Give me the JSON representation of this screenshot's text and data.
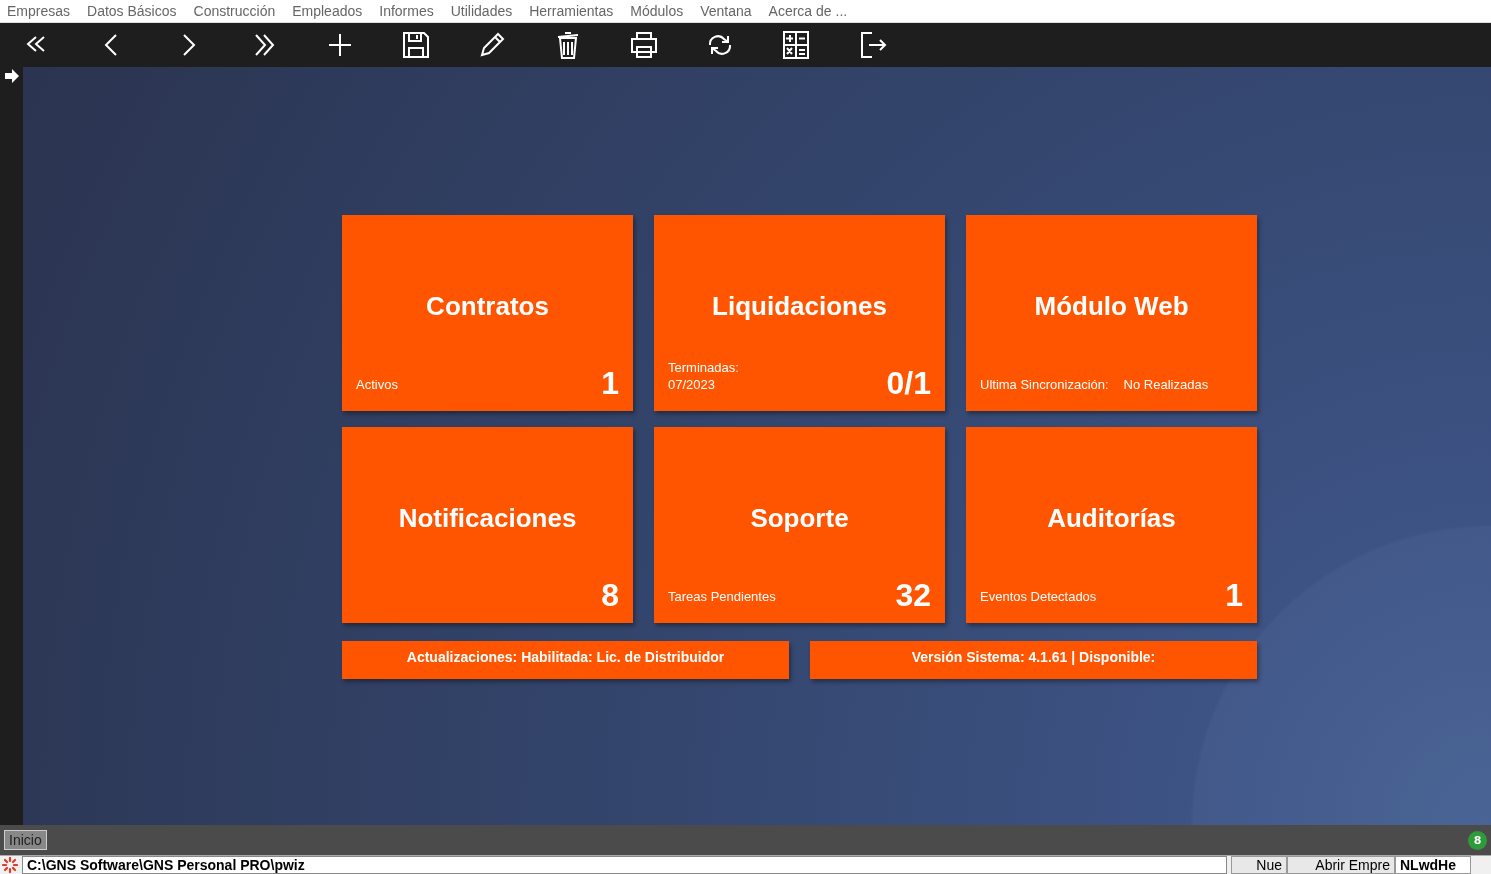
{
  "menu": [
    "Empresas",
    "Datos Básicos",
    "Construcción",
    "Empleados",
    "Informes",
    "Utilidades",
    "Herramientas",
    "Módulos",
    "Ventana",
    "Acerca de ..."
  ],
  "cards": [
    {
      "title": "Contratos",
      "kind": "stacked",
      "notes": [
        "Activos"
      ],
      "value": "1"
    },
    {
      "title": "Liquidaciones",
      "kind": "stacked",
      "notes": [
        "Terminadas:",
        "07/2023"
      ],
      "value": "0/1"
    },
    {
      "title": "Módulo Web",
      "kind": "inline",
      "notes": [
        "Ultima Sincronización:",
        "No Realizadas"
      ]
    },
    {
      "title": "Notificaciones",
      "kind": "stacked",
      "value": "8"
    },
    {
      "title": "Soporte",
      "kind": "stacked",
      "notes": [
        "Tareas Pendientes"
      ],
      "value": "32"
    },
    {
      "title": "Auditorías",
      "kind": "stacked",
      "notes": [
        "Eventos Detectados"
      ],
      "value": "1"
    }
  ],
  "banners": [
    "Actualizaciones: Habilitada: Lic. de Distribuidor",
    "Versión Sistema: 4.1.61 | Disponible:"
  ],
  "taskbar": {
    "tabs": [
      {
        "label": "Inicio",
        "selected": true
      }
    ],
    "badge": "8"
  },
  "status_bar": {
    "path": "C:\\GNS Software\\GNS Personal PRO\\pwiz",
    "panels": [
      "Nue",
      "Abrir Empre",
      "NLwdHe"
    ]
  }
}
